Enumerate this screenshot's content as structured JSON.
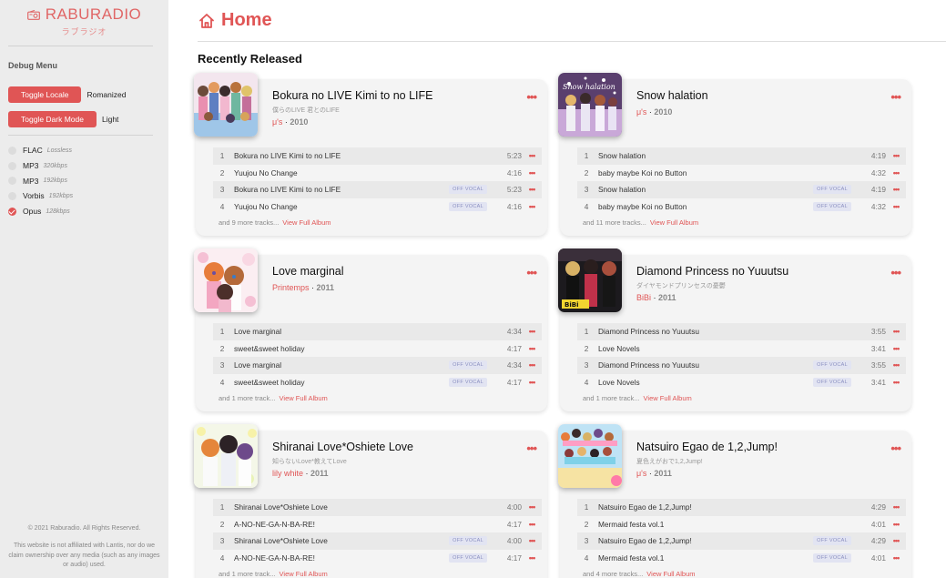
{
  "sidebar": {
    "brand": "RABURADIO",
    "brand_sub": "ラブラジオ",
    "debug_title": "Debug Menu",
    "toggles": [
      {
        "label": "Toggle Locale",
        "value": "Romanized"
      },
      {
        "label": "Toggle Dark Mode",
        "value": "Light"
      }
    ],
    "qualities": [
      {
        "name": "FLAC",
        "rate": "Lossless",
        "selected": false
      },
      {
        "name": "MP3",
        "rate": "320kbps",
        "selected": false
      },
      {
        "name": "MP3",
        "rate": "192kbps",
        "selected": false
      },
      {
        "name": "Vorbis",
        "rate": "192kbps",
        "selected": false
      },
      {
        "name": "Opus",
        "rate": "128kbps",
        "selected": true
      }
    ],
    "copyright": "© 2021 Raburadio. All Rights Reserved.",
    "disclaimer": "This website is not affiliated with Lantis, nor do we claim ownership over any media (such as any images or audio) used."
  },
  "page": {
    "title": "Home",
    "section_title": "Recently Released"
  },
  "colors": {
    "accent": "#e05555",
    "sidebar_bg": "#ececec",
    "card_bg": "#f4f4f4"
  },
  "albums": [
    {
      "title": "Bokura no LIVE Kimi to no LIFE",
      "subtitle": "僕らのLIVE 君とのLIFE",
      "artist": "μ's",
      "year": "2010",
      "more_text": "and 9 more tracks...",
      "view_full": "View Full Album",
      "tracks": [
        {
          "num": "1",
          "title": "Bokura no LIVE Kimi to no LIFE",
          "badge": "",
          "duration": "5:23"
        },
        {
          "num": "2",
          "title": "Yuujou No Change",
          "badge": "",
          "duration": "4:16"
        },
        {
          "num": "3",
          "title": "Bokura no LIVE Kimi to no LIFE",
          "badge": "OFF VOCAL",
          "duration": "5:23"
        },
        {
          "num": "4",
          "title": "Yuujou No Change",
          "badge": "OFF VOCAL",
          "duration": "4:16"
        }
      ]
    },
    {
      "title": "Snow halation",
      "subtitle": "",
      "artist": "μ's",
      "year": "2010",
      "more_text": "and 11 more tracks...",
      "view_full": "View Full Album",
      "tracks": [
        {
          "num": "1",
          "title": "Snow halation",
          "badge": "",
          "duration": "4:19"
        },
        {
          "num": "2",
          "title": "baby maybe Koi no Button",
          "badge": "",
          "duration": "4:32"
        },
        {
          "num": "3",
          "title": "Snow halation",
          "badge": "OFF VOCAL",
          "duration": "4:19"
        },
        {
          "num": "4",
          "title": "baby maybe Koi no Button",
          "badge": "OFF VOCAL",
          "duration": "4:32"
        }
      ]
    },
    {
      "title": "Love marginal",
      "subtitle": "",
      "artist": "Printemps",
      "year": "2011",
      "more_text": "and 1 more track...",
      "view_full": "View Full Album",
      "tracks": [
        {
          "num": "1",
          "title": "Love marginal",
          "badge": "",
          "duration": "4:34"
        },
        {
          "num": "2",
          "title": "sweet&sweet holiday",
          "badge": "",
          "duration": "4:17"
        },
        {
          "num": "3",
          "title": "Love marginal",
          "badge": "OFF VOCAL",
          "duration": "4:34"
        },
        {
          "num": "4",
          "title": "sweet&sweet holiday",
          "badge": "OFF VOCAL",
          "duration": "4:17"
        }
      ]
    },
    {
      "title": "Diamond Princess no Yuuutsu",
      "subtitle": "ダイヤモンドプリンセスの憂鬱",
      "artist": "BiBi",
      "year": "2011",
      "more_text": "and 1 more track...",
      "view_full": "View Full Album",
      "tracks": [
        {
          "num": "1",
          "title": "Diamond Princess no Yuuutsu",
          "badge": "",
          "duration": "3:55"
        },
        {
          "num": "2",
          "title": "Love Novels",
          "badge": "",
          "duration": "3:41"
        },
        {
          "num": "3",
          "title": "Diamond Princess no Yuuutsu",
          "badge": "OFF VOCAL",
          "duration": "3:55"
        },
        {
          "num": "4",
          "title": "Love Novels",
          "badge": "OFF VOCAL",
          "duration": "3:41"
        }
      ]
    },
    {
      "title": "Shiranai Love*Oshiete Love",
      "subtitle": "知らないLove*教えてLove",
      "artist": "lily white",
      "year": "2011",
      "more_text": "and 1 more track...",
      "view_full": "View Full Album",
      "tracks": [
        {
          "num": "1",
          "title": "Shiranai Love*Oshiete Love",
          "badge": "",
          "duration": "4:00"
        },
        {
          "num": "2",
          "title": "A-NO-NE-GA-N-BA-RE!",
          "badge": "",
          "duration": "4:17"
        },
        {
          "num": "3",
          "title": "Shiranai Love*Oshiete Love",
          "badge": "OFF VOCAL",
          "duration": "4:00"
        },
        {
          "num": "4",
          "title": "A-NO-NE-GA-N-BA-RE!",
          "badge": "OFF VOCAL",
          "duration": "4:17"
        }
      ]
    },
    {
      "title": "Natsuiro Egao de 1,2,Jump!",
      "subtitle": "夏色えがおで1,2,Jump!",
      "artist": "μ's",
      "year": "2011",
      "more_text": "and 4 more tracks...",
      "view_full": "View Full Album",
      "tracks": [
        {
          "num": "1",
          "title": "Natsuiro Egao de 1,2,Jump!",
          "badge": "",
          "duration": "4:29"
        },
        {
          "num": "2",
          "title": "Mermaid festa vol.1",
          "badge": "",
          "duration": "4:01"
        },
        {
          "num": "3",
          "title": "Natsuiro Egao de 1,2,Jump!",
          "badge": "OFF VOCAL",
          "duration": "4:29"
        },
        {
          "num": "4",
          "title": "Mermaid festa vol.1",
          "badge": "OFF VOCAL",
          "duration": "4:01"
        }
      ]
    }
  ]
}
